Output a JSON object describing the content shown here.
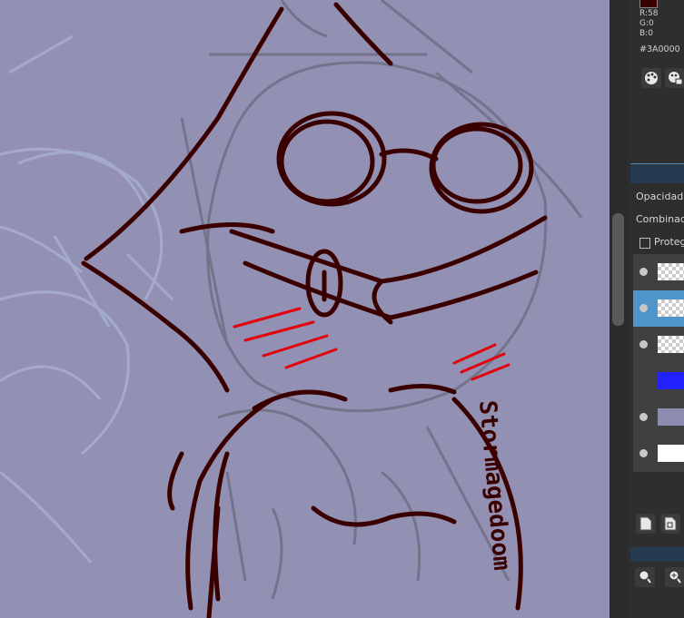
{
  "color": {
    "r_label": "R:58",
    "g_label": "G:0",
    "b_label": "B:0",
    "hex": "#3A0000",
    "current": "#3a0000"
  },
  "canvas": {
    "signature": "Stormagedoom",
    "background": "#9291b4"
  },
  "layer_properties": {
    "opacity_label": "Opacidad",
    "blend_label": "Combinació",
    "protect_label": "Proteg"
  },
  "layers": [
    {
      "thumb": "transparent",
      "selected": false,
      "visible": true
    },
    {
      "thumb": "transparent",
      "selected": true,
      "visible": true
    },
    {
      "thumb": "transparent",
      "selected": false,
      "visible": true
    },
    {
      "thumb": "blue-fill",
      "selected": false,
      "visible": false
    },
    {
      "thumb": "sketch",
      "selected": false,
      "visible": true
    },
    {
      "thumb": "white-fill",
      "selected": false,
      "visible": true
    }
  ],
  "icons": {
    "palette": "palette-icon",
    "palette_edit": "palette-edit-icon",
    "new_layer": "new-layer-icon",
    "layer_copy": "copy-layer-icon",
    "zoom_fit": "zoom-fit-icon",
    "zoom_in": "zoom-in-icon"
  }
}
